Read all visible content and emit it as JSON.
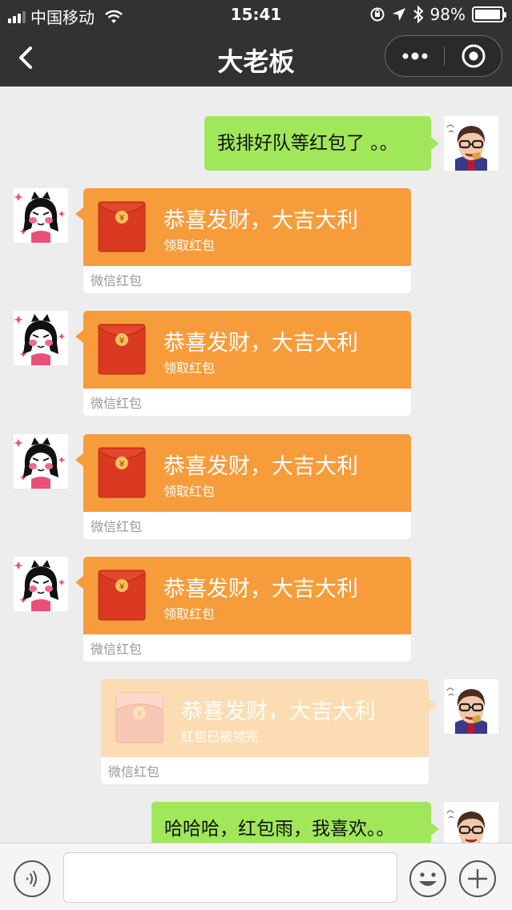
{
  "status_bar": {
    "carrier": "中国移动",
    "time": "15:41",
    "battery_text": "98%",
    "battery_level": 0.98
  },
  "nav": {
    "title": "大老板"
  },
  "messages": [
    {
      "kind": "text",
      "side": "right",
      "text": "我排好队等红包了 。。"
    },
    {
      "kind": "red_packet",
      "side": "left",
      "title": "恭喜发财，大吉大利",
      "subtitle": "领取红包",
      "footer": "微信红包"
    },
    {
      "kind": "red_packet",
      "side": "left",
      "title": "恭喜发财，大吉大利",
      "subtitle": "领取红包",
      "footer": "微信红包"
    },
    {
      "kind": "red_packet",
      "side": "left",
      "title": "恭喜发财，大吉大利",
      "subtitle": "领取红包",
      "footer": "微信红包"
    },
    {
      "kind": "red_packet",
      "side": "left",
      "title": "恭喜发财，大吉大利",
      "subtitle": "领取红包",
      "footer": "微信红包"
    },
    {
      "kind": "red_packet",
      "side": "right",
      "opened": true,
      "title": "恭喜发财，大吉大利",
      "subtitle": "红包已被领完",
      "footer": "微信红包"
    },
    {
      "kind": "text",
      "side": "right",
      "text": "哈哈哈，红包雨，我喜欢。。"
    }
  ],
  "input": {
    "value": "",
    "placeholder": ""
  },
  "colors": {
    "bar": "#323232",
    "background": "#ededed",
    "bubble_green": "#a0e75a",
    "red_packet_orange": "#f79c3a",
    "red_packet_opened": "#fcdcb2",
    "envelope_red": "#d93a21"
  },
  "icons": {
    "back": "chevron-left-icon",
    "more": "more-dots-icon",
    "close": "target-circle-icon",
    "voice": "voice-icon",
    "emoji": "emoji-icon",
    "plus": "plus-icon",
    "red_packet": "red-envelope-icon"
  }
}
